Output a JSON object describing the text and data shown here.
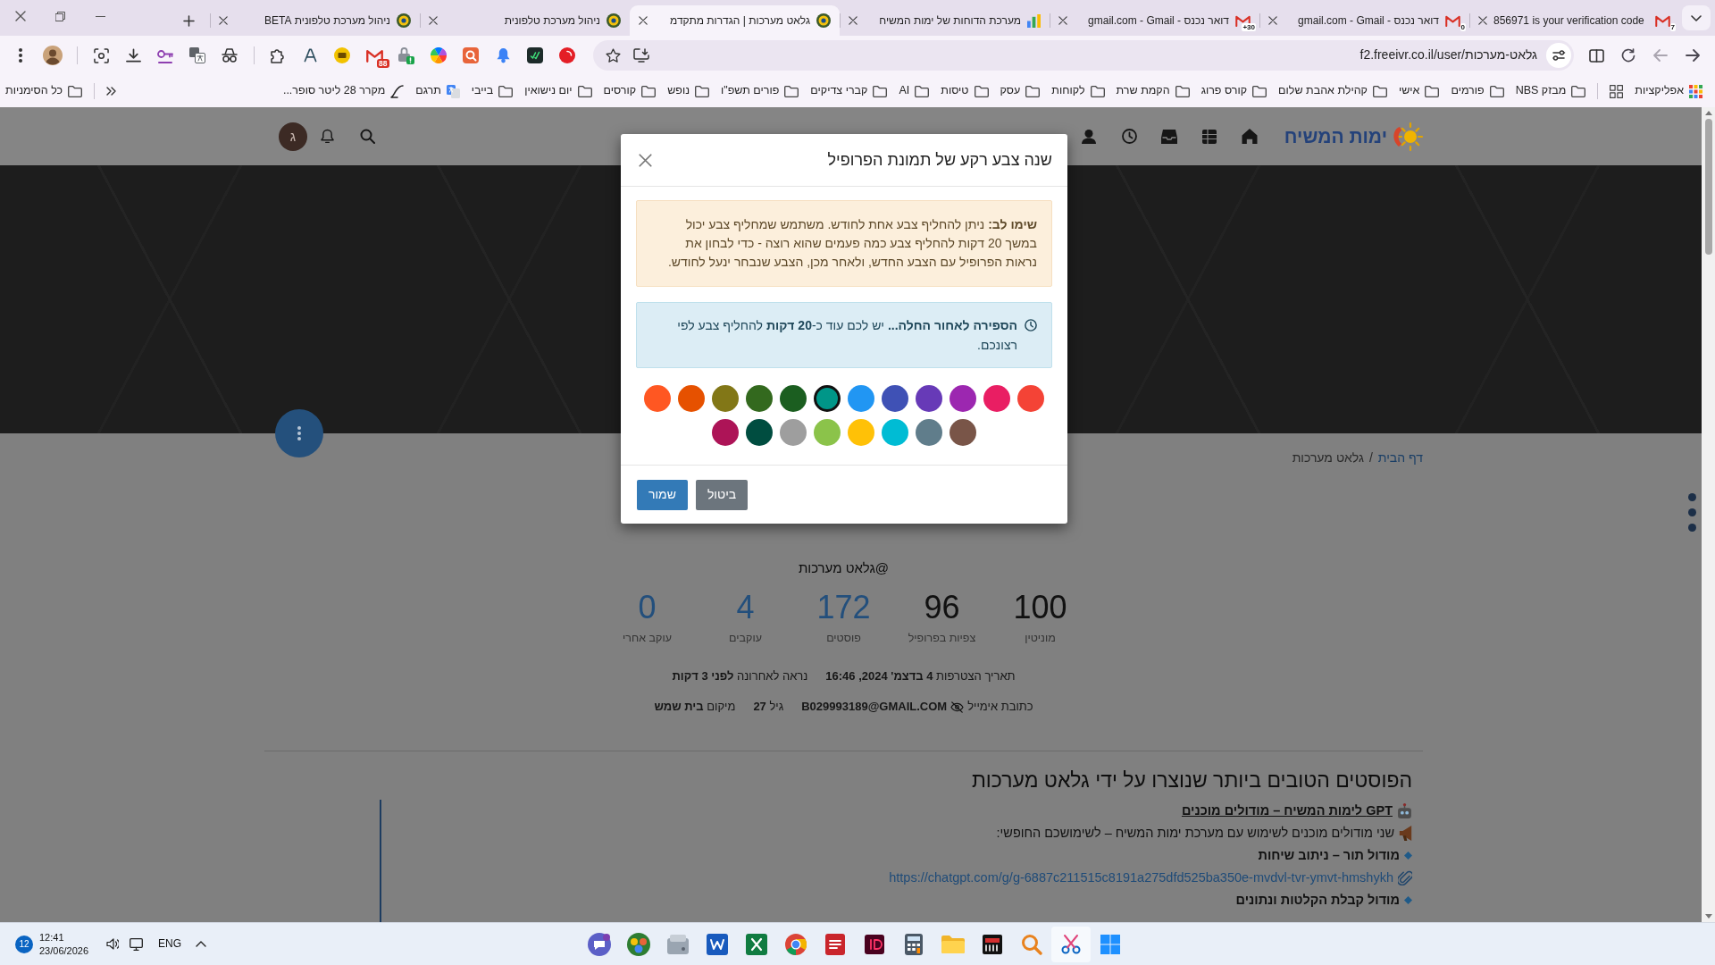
{
  "browser": {
    "tabs": [
      {
        "title": "856971 is your verification code",
        "kind": "mail",
        "badge": "7",
        "selected": false
      },
      {
        "title": "דואר נכנס - gmail.com - Gmail",
        "kind": "mail",
        "badge": "0",
        "selected": false
      },
      {
        "title": "דואר נכנס - gmail.com - Gmail",
        "kind": "mail",
        "badge": "30+",
        "selected": false
      },
      {
        "title": "מערכת הדוחות של ימות המשיח",
        "kind": "report",
        "selected": false
      },
      {
        "title": "גלאט מערכות | הגדרות מתקדמ",
        "kind": "site",
        "selected": true
      },
      {
        "title": "ניהול מערכת טלפונית",
        "kind": "site",
        "selected": false
      },
      {
        "title": "ניהול מערכת טלפונית BETA",
        "kind": "site",
        "selected": false
      }
    ],
    "url": "f2.freeivr.co.il/user/גלאט-מערכות",
    "extension_badge": "88",
    "bookmarks": {
      "apps_label": "אפליקציות",
      "items": [
        {
          "label": "מבזק NBS",
          "kind": "folder"
        },
        {
          "label": "פורמים",
          "kind": "folder"
        },
        {
          "label": "אישי",
          "kind": "folder"
        },
        {
          "label": "קהילת אהבת שלום",
          "kind": "folder"
        },
        {
          "label": "קורס פרוג",
          "kind": "folder"
        },
        {
          "label": "הקמת שרת",
          "kind": "folder"
        },
        {
          "label": "לקוחות",
          "kind": "folder"
        },
        {
          "label": "עסק",
          "kind": "folder"
        },
        {
          "label": "טיסות",
          "kind": "folder"
        },
        {
          "label": "AI",
          "kind": "folder"
        },
        {
          "label": "קברי צדיקים",
          "kind": "folder"
        },
        {
          "label": "פורים תשפ\"ו",
          "kind": "folder"
        },
        {
          "label": "נופש",
          "kind": "folder"
        },
        {
          "label": "קורסים",
          "kind": "folder"
        },
        {
          "label": "יום נישואין",
          "kind": "folder"
        },
        {
          "label": "בייבי",
          "kind": "folder"
        },
        {
          "label": "תרגם",
          "kind": "translate"
        },
        {
          "label": "מקרר 28 ליטר סופר...",
          "kind": "script"
        }
      ],
      "all_label": "כל הסימניות"
    }
  },
  "navbar": {
    "logo_text": "ימות המשיח",
    "avatar_letter": "ג"
  },
  "breadcrumb": {
    "items": [
      {
        "label": "דף הבית",
        "kind": "link"
      },
      {
        "label": "גלאט מערכות",
        "kind": "current"
      }
    ],
    "separator": "/"
  },
  "profile": {
    "handle": "@גלאט מערכות",
    "stats": [
      {
        "value": "100",
        "label": "מוניטין",
        "kind": "plain"
      },
      {
        "value": "96",
        "label": "צפיות בפרופיל",
        "kind": "plain"
      },
      {
        "value": "172",
        "label": "פוסטים",
        "kind": "link"
      },
      {
        "value": "4",
        "label": "עוקבים",
        "kind": "link"
      },
      {
        "value": "0",
        "label": "עוקב אחרי",
        "kind": "link"
      }
    ],
    "details": [
      [
        {
          "kind": "text",
          "text": "תאריך הצטרפות **4 בדצמ' 2024, 16:46**"
        },
        {
          "kind": "text",
          "text": "נראה לאחרונה **לפני 3 דקות**"
        }
      ],
      [
        {
          "kind": "email",
          "label": "כתובת אימייל",
          "value": "B029993189@GMAIL.COM"
        },
        {
          "kind": "text",
          "text": "גיל **27**"
        },
        {
          "kind": "text",
          "text": "מיקום **בית שמש**"
        }
      ]
    ]
  },
  "posts": {
    "heading": "הפוסטים הטובים ביותר שנוצרו על ידי גלאט מערכות",
    "title": "GPT לימות המשיח – מודולים מוכנים",
    "intro": "שני מודולים מוכנים לשימוש עם מערכת ימות המשיח – לשימושכם החופשי:",
    "modules": [
      {
        "title": "מודול תור – ניתוב שיחות",
        "link": "https://chatgpt.com/g/g-6887c211515c8191a275dfd525ba350e-mvdvl-tvr-ymvt-hmshykh"
      },
      {
        "title": "מודול קבלת הקלטות ונתונים"
      }
    ]
  },
  "modal": {
    "title": "שנה צבע רקע של תמונת הפרופיל",
    "warning": "**שימו לב:** ניתן להחליף צבע אחת לחודש. משתמש שמחליף צבע יכול במשך 20 דקות להחליף צבע כמה פעמים שהוא רוצה - כדי לבחון את נראות הפרופיל עם הצבע החדש, ולאחר מכן, הצבע שנבחר ינעל לחודש.",
    "countdown": "**הספירה לאחור החלה...** יש לכם עוד כ-**20 דקות** להחליף צבע לפי רצונכם.",
    "swatches": [
      {
        "color": "#f44336",
        "selected": false
      },
      {
        "color": "#e91e63",
        "selected": false
      },
      {
        "color": "#9c27b0",
        "selected": false
      },
      {
        "color": "#673ab7",
        "selected": false
      },
      {
        "color": "#3f51b5",
        "selected": false
      },
      {
        "color": "#2196f3",
        "selected": false
      },
      {
        "color": "#009688",
        "selected": true
      },
      {
        "color": "#1b5e20",
        "selected": false
      },
      {
        "color": "#33691e",
        "selected": false
      },
      {
        "color": "#827717",
        "selected": false
      },
      {
        "color": "#e65100",
        "selected": false
      },
      {
        "color": "#ff5722",
        "selected": false
      },
      {
        "color": "#795548",
        "selected": false
      },
      {
        "color": "#607d8b",
        "selected": false
      },
      {
        "color": "#00bcd4",
        "selected": false
      },
      {
        "color": "#ffc107",
        "selected": false
      },
      {
        "color": "#8bc34a",
        "selected": false
      },
      {
        "color": "#9e9e9e",
        "selected": false
      },
      {
        "color": "#004d40",
        "selected": false
      },
      {
        "color": "#ad1457",
        "selected": false
      }
    ],
    "buttons": [
      {
        "label": "ביטול",
        "kind": "secondary"
      },
      {
        "label": "שמור",
        "kind": "primary"
      }
    ]
  },
  "taskbar": {
    "notifications": "12",
    "time": "12:41",
    "date": "23/06/2026",
    "language": "ENG"
  }
}
